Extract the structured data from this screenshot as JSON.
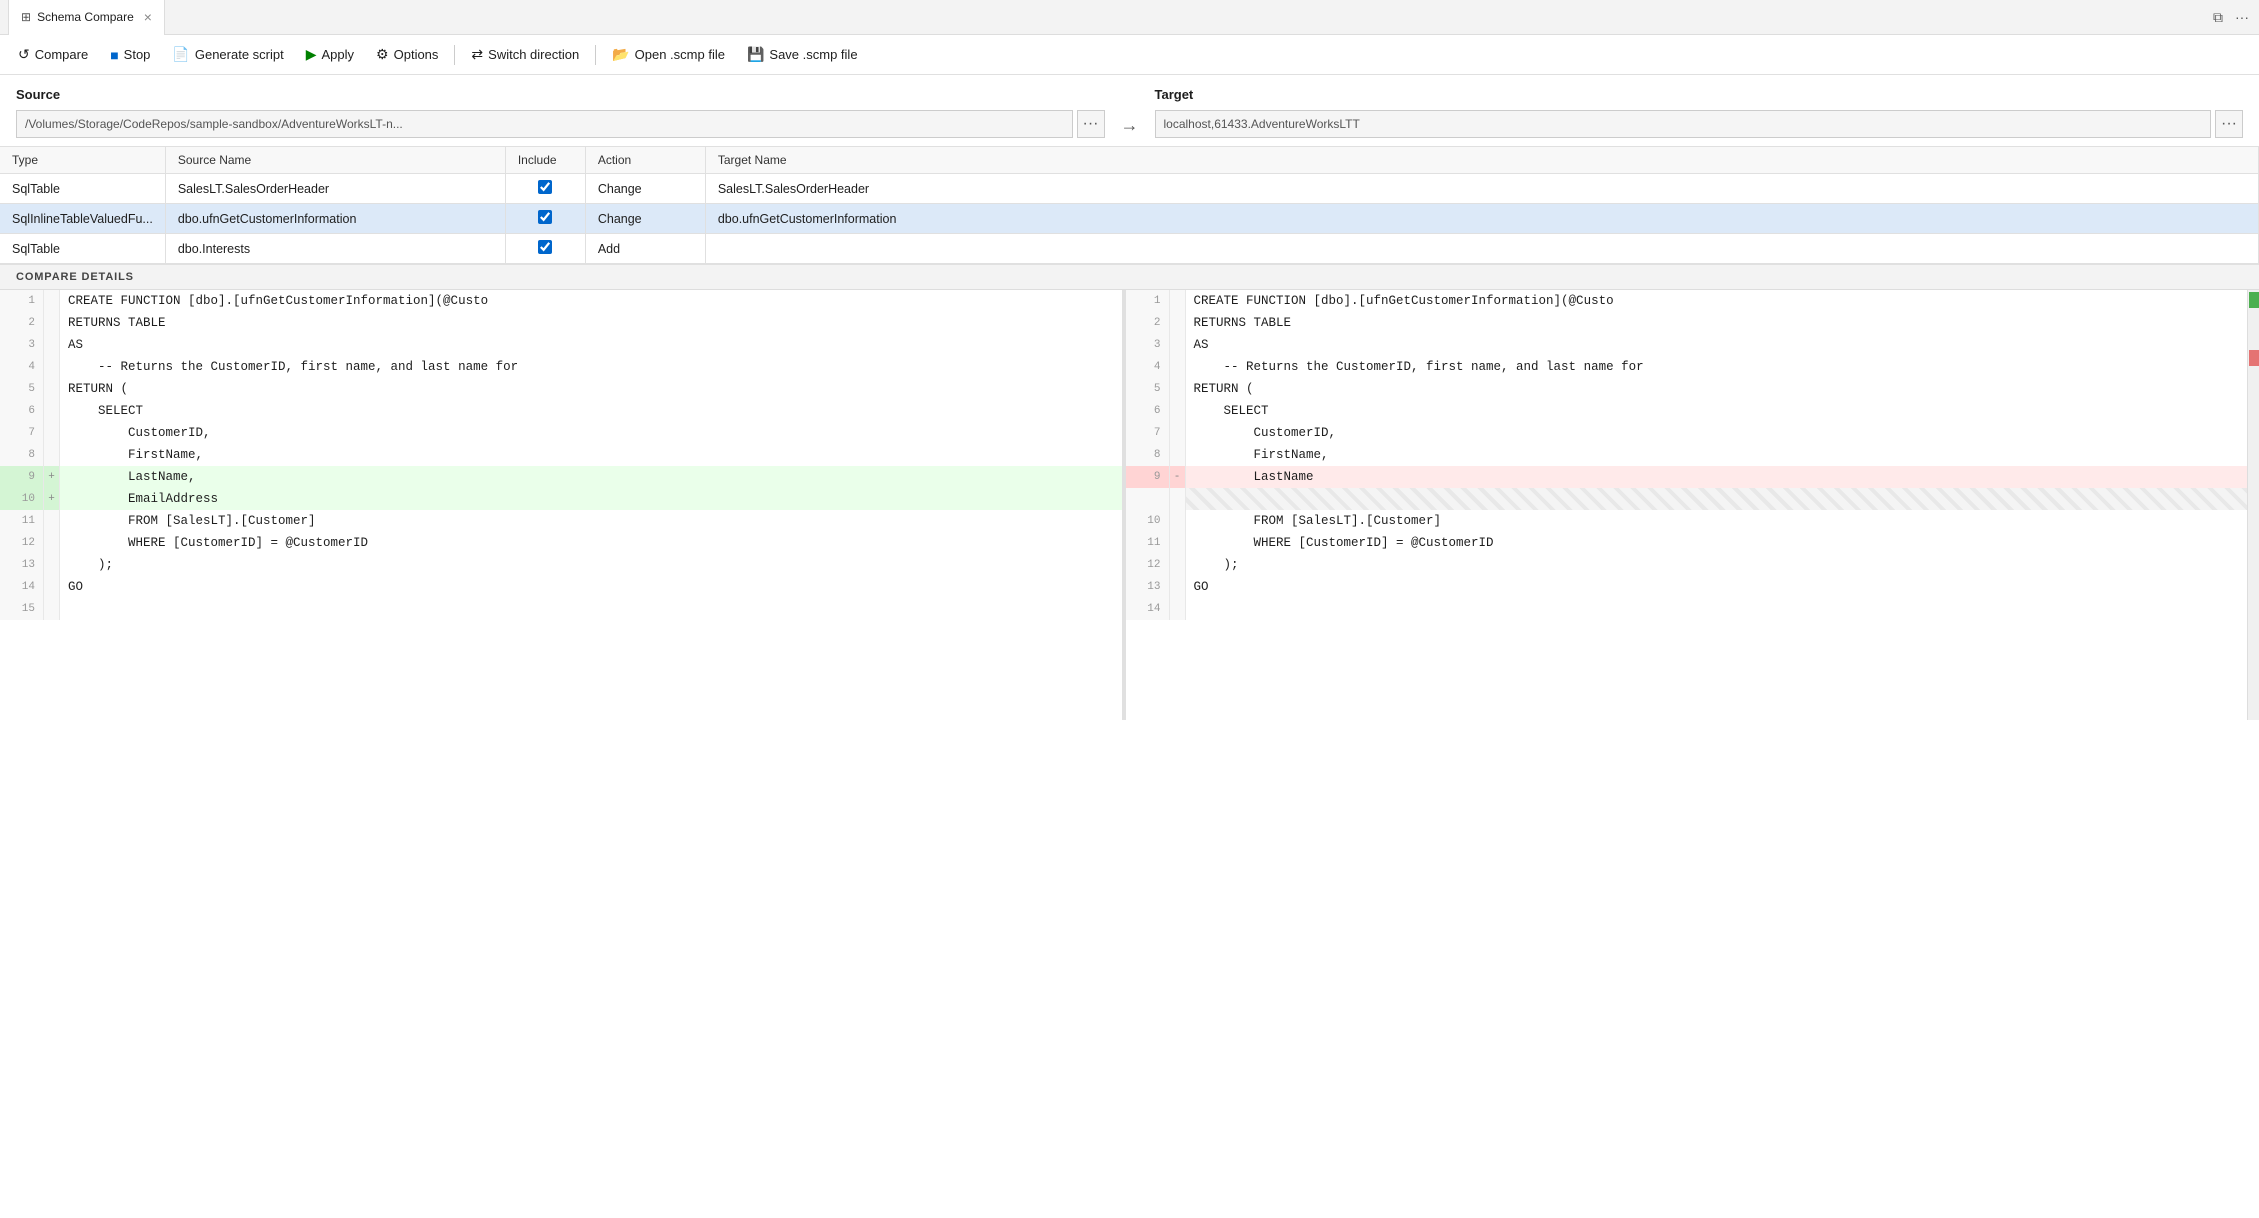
{
  "tab": {
    "icon": "⊞",
    "label": "Schema Compare",
    "close": "×"
  },
  "toolbar": {
    "compare": "Compare",
    "stop": "Stop",
    "generate_script": "Generate script",
    "apply": "Apply",
    "options": "Options",
    "switch_direction": "Switch direction",
    "open_scmp": "Open .scmp file",
    "save_scmp": "Save .scmp file"
  },
  "source": {
    "label": "Source",
    "value": "/Volumes/Storage/CodeRepos/sample-sandbox/AdventureWorksLT-n...",
    "dots": "···"
  },
  "target": {
    "label": "Target",
    "value": "localhost,61433.AdventureWorksLTT",
    "dots": "···"
  },
  "table": {
    "columns": [
      "Type",
      "Source Name",
      "Include",
      "Action",
      "Target Name"
    ],
    "rows": [
      {
        "type": "SqlTable",
        "source": "SalesLT.SalesOrderHeader",
        "include": true,
        "action": "Change",
        "target": "SalesLT.SalesOrderHeader",
        "selected": false
      },
      {
        "type": "SqlInlineTableValuedFu...",
        "source": "dbo.ufnGetCustomerInformation",
        "include": true,
        "action": "Change",
        "target": "dbo.ufnGetCustomerInformation",
        "selected": true
      },
      {
        "type": "SqlTable",
        "source": "dbo.Interests",
        "include": true,
        "action": "Add",
        "target": "",
        "selected": false
      }
    ]
  },
  "compare_details_label": "COMPARE DETAILS",
  "diff": {
    "left": [
      {
        "num": 1,
        "marker": "",
        "text": "CREATE FUNCTION [dbo].[ufnGetCustomerInformation](@Custo",
        "type": "normal"
      },
      {
        "num": 2,
        "marker": "",
        "text": "RETURNS TABLE",
        "type": "normal"
      },
      {
        "num": 3,
        "marker": "",
        "text": "AS",
        "type": "normal"
      },
      {
        "num": 4,
        "marker": "",
        "text": "    -- Returns the CustomerID, first name, and last name for",
        "type": "normal"
      },
      {
        "num": 5,
        "marker": "",
        "text": "RETURN (",
        "type": "normal"
      },
      {
        "num": 6,
        "marker": "",
        "text": "    SELECT",
        "type": "normal"
      },
      {
        "num": 7,
        "marker": "",
        "text": "        CustomerID,",
        "type": "normal"
      },
      {
        "num": 8,
        "marker": "",
        "text": "        FirstName,",
        "type": "normal"
      },
      {
        "num": 9,
        "marker": "+",
        "text": "        LastName,",
        "type": "added"
      },
      {
        "num": 10,
        "marker": "+",
        "text": "        EmailAddress",
        "type": "added"
      },
      {
        "num": 11,
        "marker": "",
        "text": "        FROM [SalesLT].[Customer]",
        "type": "normal"
      },
      {
        "num": 12,
        "marker": "",
        "text": "        WHERE [CustomerID] = @CustomerID",
        "type": "normal"
      },
      {
        "num": 13,
        "marker": "",
        "text": "    );",
        "type": "normal"
      },
      {
        "num": 14,
        "marker": "",
        "text": "GO",
        "type": "normal"
      },
      {
        "num": 15,
        "marker": "",
        "text": "",
        "type": "normal"
      }
    ],
    "right": [
      {
        "num": 1,
        "marker": "",
        "text": "CREATE FUNCTION [dbo].[ufnGetCustomerInformation](@Custo",
        "type": "normal"
      },
      {
        "num": 2,
        "marker": "",
        "text": "RETURNS TABLE",
        "type": "normal"
      },
      {
        "num": 3,
        "marker": "",
        "text": "AS",
        "type": "normal"
      },
      {
        "num": 4,
        "marker": "",
        "text": "    -- Returns the CustomerID, first name, and last name for",
        "type": "normal"
      },
      {
        "num": 5,
        "marker": "",
        "text": "RETURN (",
        "type": "normal"
      },
      {
        "num": 6,
        "marker": "",
        "text": "    SELECT",
        "type": "normal"
      },
      {
        "num": 7,
        "marker": "",
        "text": "        CustomerID,",
        "type": "normal"
      },
      {
        "num": 8,
        "marker": "",
        "text": "        FirstName,",
        "type": "normal"
      },
      {
        "num": 9,
        "marker": "-",
        "text": "        LastName",
        "type": "removed"
      },
      {
        "num": null,
        "marker": "",
        "text": "",
        "type": "placeholder"
      },
      {
        "num": 10,
        "marker": "",
        "text": "        FROM [SalesLT].[Customer]",
        "type": "normal"
      },
      {
        "num": 11,
        "marker": "",
        "text": "        WHERE [CustomerID] = @CustomerID",
        "type": "normal"
      },
      {
        "num": 12,
        "marker": "",
        "text": "    );",
        "type": "normal"
      },
      {
        "num": 13,
        "marker": "",
        "text": "GO",
        "type": "normal"
      },
      {
        "num": 14,
        "marker": "",
        "text": "",
        "type": "normal"
      }
    ]
  }
}
